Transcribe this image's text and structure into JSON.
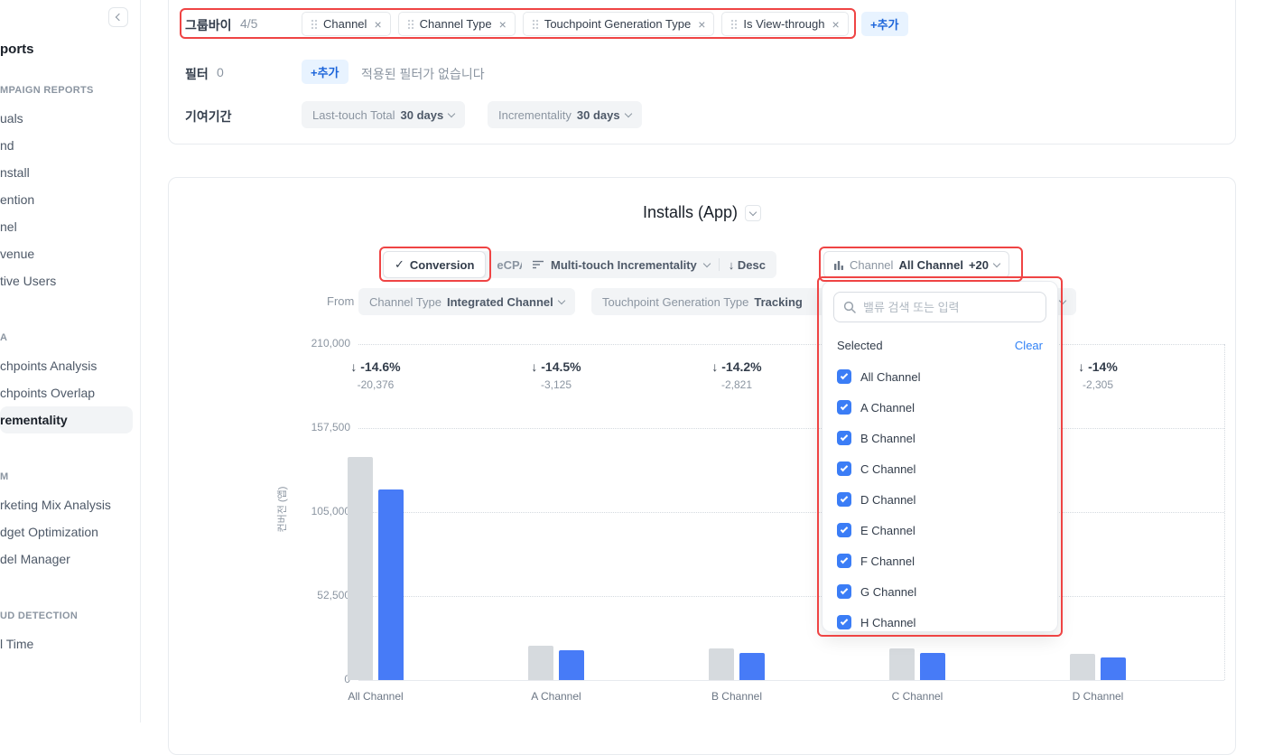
{
  "colors": {
    "accent_blue": "#3182f6",
    "bar_blue": "#477bf7",
    "bar_gray": "#d6dade",
    "highlight_red": "#ef4444"
  },
  "sidebar": {
    "title": "ports",
    "sections": [
      {
        "header": "MPAIGN REPORTS",
        "items": [
          {
            "label": "uals"
          },
          {
            "label": "nd"
          },
          {
            "label": "nstall"
          },
          {
            "label": "ention"
          },
          {
            "label": "nel"
          },
          {
            "label": "venue"
          },
          {
            "label": "tive Users"
          }
        ]
      },
      {
        "header": "A",
        "items": [
          {
            "label": "chpoints Analysis"
          },
          {
            "label": "chpoints Overlap"
          },
          {
            "label": "rementality",
            "active": true
          }
        ]
      },
      {
        "header": "M",
        "items": [
          {
            "label": "rketing Mix Analysis"
          },
          {
            "label": "dget Optimization"
          },
          {
            "label": "del Manager"
          }
        ]
      },
      {
        "header": "UD DETECTION",
        "items": [
          {
            "label": "l Time"
          }
        ]
      }
    ]
  },
  "filters_card": {
    "groupby_label": "그룹바이",
    "groupby_count": "4/5",
    "groupby_chips": [
      "Channel",
      "Channel Type",
      "Touchpoint Generation Type",
      "Is View-through"
    ],
    "add_button": "+추가",
    "filter_label": "필터",
    "filter_count": "0",
    "filter_empty": "적용된 필터가 없습니다",
    "attribution_label": "기여기간",
    "attribution_dropdowns": [
      {
        "name": "Last-touch Total",
        "value": "30 days"
      },
      {
        "name": "Incrementality",
        "value": "30 days"
      }
    ]
  },
  "chart_card": {
    "title": "Installs (App)",
    "toolbar": {
      "conversion_tab": "Conversion",
      "check_glyph": "✓",
      "ecpa_tab": "eCPA",
      "sort_by": "Multi-touch Incrementality",
      "sort_dir": "↓ Desc",
      "selector_label": "Channel",
      "selector_value": "All Channel",
      "selector_badge": "+20"
    },
    "subfilters": {
      "from_label": "From",
      "chip1_name": "Channel Type",
      "chip1_value": "Integrated Channel",
      "chip2_name": "Touchpoint Generation Type",
      "chip2_value": "Tracking"
    },
    "dropdown_panel": {
      "search_placeholder": "밸류 검색 또는 입력",
      "selected_label": "Selected",
      "clear_label": "Clear",
      "options": [
        {
          "label": "All Channel",
          "checked": true
        },
        {
          "label": "A Channel",
          "checked": true
        },
        {
          "label": "B Channel",
          "checked": true
        },
        {
          "label": "C Channel",
          "checked": true
        },
        {
          "label": "D Channel",
          "checked": true
        },
        {
          "label": "E Channel",
          "checked": true
        },
        {
          "label": "F Channel",
          "checked": true
        },
        {
          "label": "G Channel",
          "checked": true
        },
        {
          "label": "H Channel",
          "checked": true
        }
      ]
    }
  },
  "chart_data": {
    "type": "bar",
    "title": "Installs (App)",
    "ylabel": "컨버전 (앱)",
    "ylim": [
      0,
      210000
    ],
    "yticks": [
      0,
      52500,
      105000,
      157500,
      210000
    ],
    "ytick_labels": [
      "0",
      "52,500",
      "105,000",
      "157,500",
      "210,000"
    ],
    "categories": [
      "All Channel",
      "A Channel",
      "B Channel",
      "C Channel",
      "D Channel"
    ],
    "series": [
      {
        "name": "Last-touch Total",
        "color": "#d6dade",
        "values": [
          139560,
          21552,
          19866,
          19600,
          16464
        ]
      },
      {
        "name": "Incrementality",
        "color": "#477bf7",
        "values": [
          119184,
          18427,
          17045,
          16850,
          14159
        ]
      }
    ],
    "annotations": [
      {
        "pct": "-14.6%",
        "diff": "-20,376"
      },
      {
        "pct": "-14.5%",
        "diff": "-3,125"
      },
      {
        "pct": "-14.2%",
        "diff": "-2,821"
      },
      null,
      {
        "pct": "-14%",
        "diff": "-2,305"
      }
    ],
    "grid": "horizontal-dotted",
    "legend": "none"
  }
}
